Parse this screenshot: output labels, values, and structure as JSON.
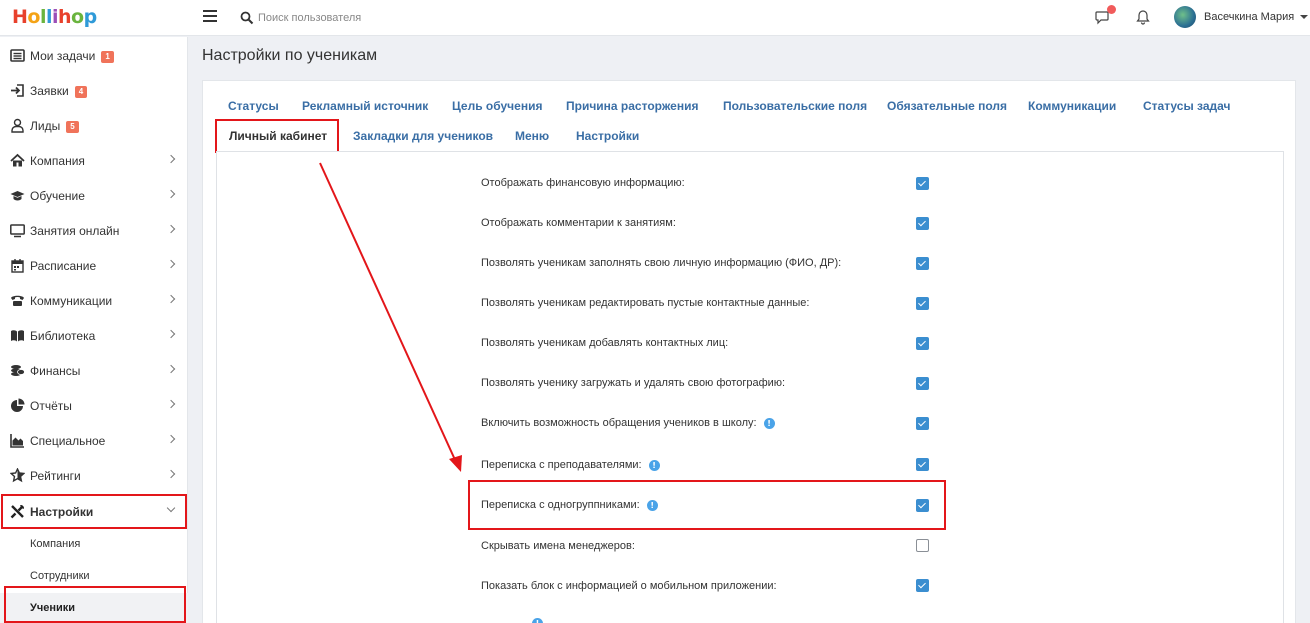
{
  "app": {
    "logo": [
      "H",
      "o",
      "l",
      "l",
      "i",
      "h",
      "o",
      "p"
    ]
  },
  "topbar": {
    "search_placeholder": "Поиск пользователя",
    "user_name": "Васечкина Мария"
  },
  "sidebar": {
    "items": [
      {
        "label": "Мои задачи",
        "icon": "list-icon",
        "badge": "1"
      },
      {
        "label": "Заявки",
        "icon": "sign-in-icon",
        "badge": "4"
      },
      {
        "label": "Лиды",
        "icon": "user-icon",
        "badge": "5"
      },
      {
        "label": "Компания",
        "icon": "home-icon"
      },
      {
        "label": "Обучение",
        "icon": "graduation-cap-icon"
      },
      {
        "label": "Занятия онлайн",
        "icon": "monitor-icon"
      },
      {
        "label": "Расписание",
        "icon": "calendar-icon"
      },
      {
        "label": "Коммуникации",
        "icon": "phone-icon"
      },
      {
        "label": "Библиотека",
        "icon": "book-icon"
      },
      {
        "label": "Финансы",
        "icon": "coins-icon"
      },
      {
        "label": "Отчёты",
        "icon": "pie-chart-icon"
      },
      {
        "label": "Специальное",
        "icon": "area-chart-icon"
      },
      {
        "label": "Рейтинги",
        "icon": "star-icon"
      },
      {
        "label": "Настройки",
        "icon": "tools-icon",
        "expanded": true
      }
    ],
    "subitems": [
      {
        "label": "Компания"
      },
      {
        "label": "Сотрудники"
      },
      {
        "label": "Ученики",
        "active": true
      }
    ]
  },
  "main": {
    "title": "Настройки по ученикам",
    "tabs_row1": [
      "Статусы",
      "Рекламный источник",
      "Цель обучения",
      "Причина расторжения",
      "Пользовательские поля",
      "Обязательные поля",
      "Коммуникации",
      "Статусы задач"
    ],
    "tabs_row2": [
      "Личный кабинет",
      "Закладки для учеников",
      "Меню",
      "Настройки"
    ],
    "active_tab": "Личный кабинет",
    "settings": [
      {
        "label": "Отображать финансовую информацию:",
        "checked": true,
        "info": false
      },
      {
        "label": "Отображать комментарии к занятиям:",
        "checked": true,
        "info": false
      },
      {
        "label": "Позволять ученикам заполнять свою личную информацию (ФИО, ДР):",
        "checked": true,
        "info": false
      },
      {
        "label": "Позволять ученикам редактировать пустые контактные данные:",
        "checked": true,
        "info": false
      },
      {
        "label": "Позволять ученикам добавлять контактных лиц:",
        "checked": true,
        "info": false
      },
      {
        "label": "Позволять ученику загружать и удалять свою фотографию:",
        "checked": true,
        "info": false
      },
      {
        "label": "Включить возможность обращения учеников в школу:",
        "checked": true,
        "info": true
      },
      {
        "label": "Переписка с преподавателями:",
        "checked": true,
        "info": true
      },
      {
        "label": "Переписка с одногруппниками:",
        "checked": true,
        "info": true
      },
      {
        "label": "Скрывать имена менеджеров:",
        "checked": false,
        "info": false
      },
      {
        "label": "Показать блок с информацией о мобильном приложении:",
        "checked": true,
        "info": false
      }
    ]
  },
  "colors": {
    "link": "#3a6ea5",
    "highlight": "#e3161a",
    "checkbox": "#3b8ed0",
    "badge": "#f0735a"
  }
}
